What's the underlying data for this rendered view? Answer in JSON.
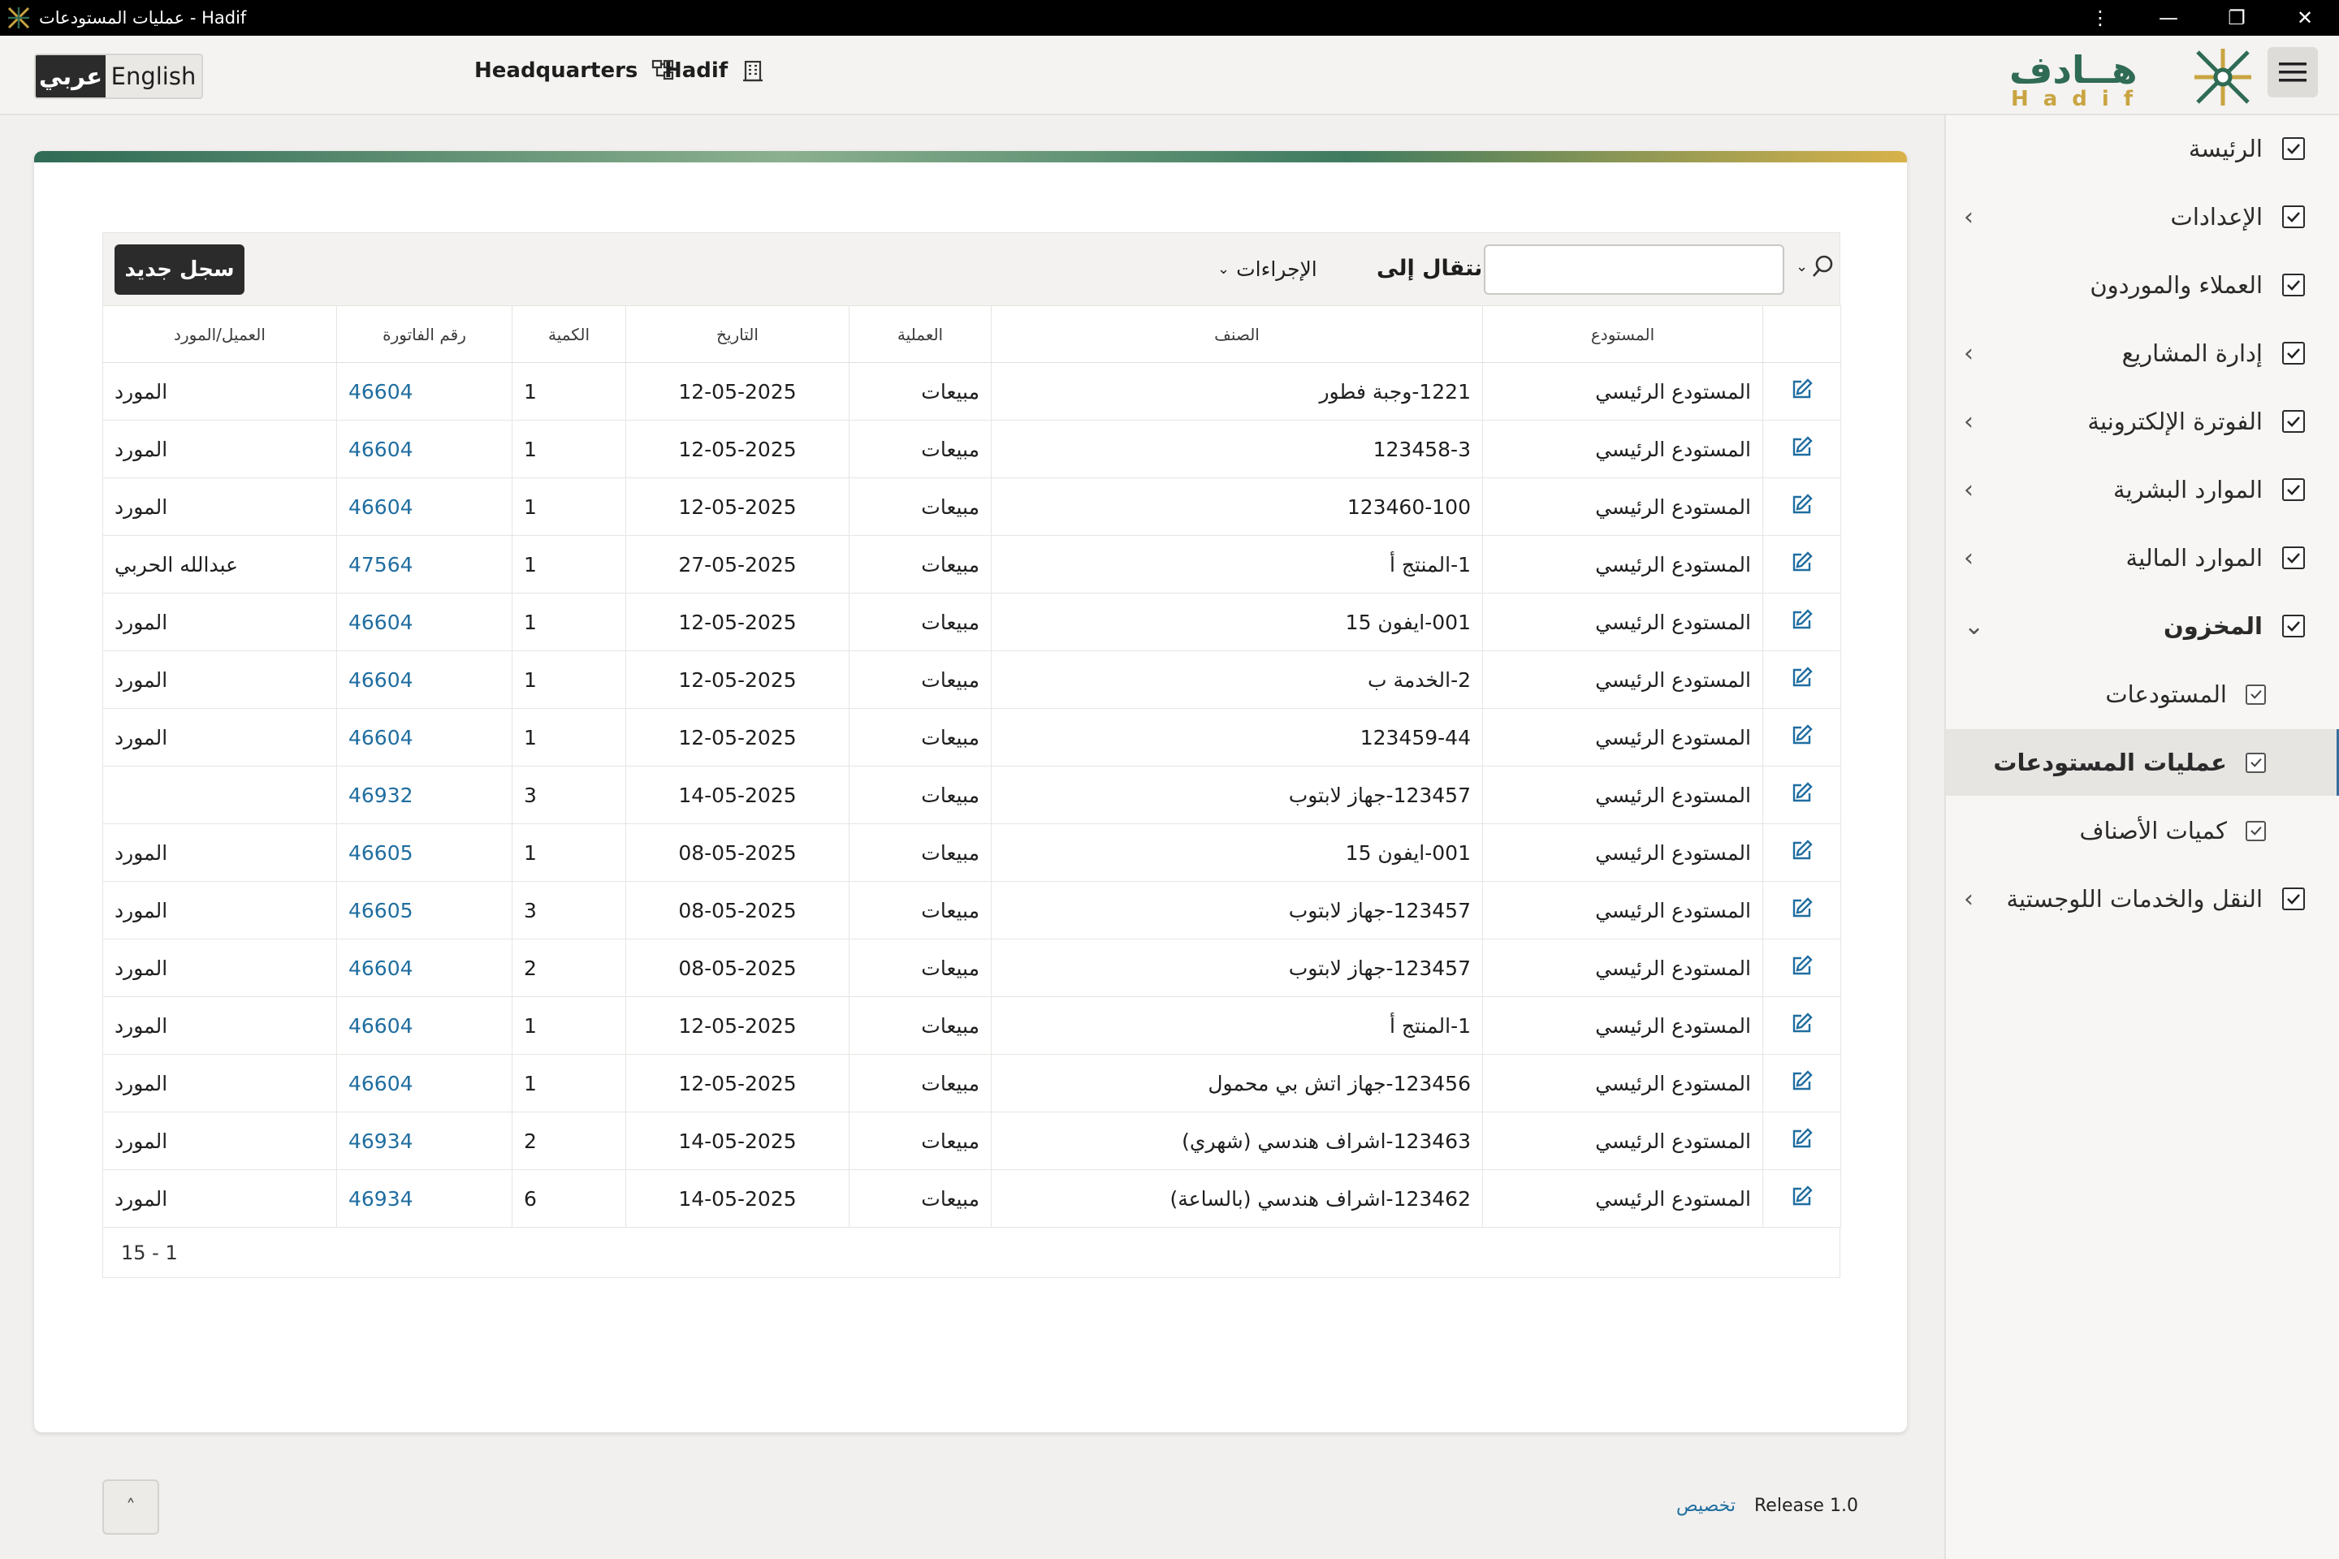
{
  "window": {
    "title": "عمليات المستودعات - Hadif",
    "controls": [
      "⋮",
      "—",
      "❐",
      "✕"
    ]
  },
  "header": {
    "lang_active": "عربي",
    "lang_inactive": "English",
    "branch": "Headquarters",
    "company": "Hadif",
    "logo_ar": "هــادف",
    "logo_en": "Hadif"
  },
  "sidebar": {
    "items": [
      {
        "label": "الرئيسة",
        "chevron": ""
      },
      {
        "label": "الإعدادات",
        "chevron": "‹"
      },
      {
        "label": "العملاء والموردون",
        "chevron": ""
      },
      {
        "label": "إدارة المشاريع",
        "chevron": "‹"
      },
      {
        "label": "الفوترة الإلكترونية",
        "chevron": "‹"
      },
      {
        "label": "الموارد البشرية",
        "chevron": "‹"
      },
      {
        "label": "الموارد المالية",
        "chevron": "‹"
      },
      {
        "label": "المخزون",
        "chevron": "⌄"
      },
      {
        "label": "المستودعات",
        "chevron": ""
      },
      {
        "label": "عمليات المستودعات",
        "chevron": ""
      },
      {
        "label": "كميات الأصناف",
        "chevron": ""
      },
      {
        "label": "النقل والخدمات اللوجستية",
        "chevron": "‹"
      }
    ]
  },
  "toolbar": {
    "new_record": "سجل جديد",
    "actions": "الإجراءات",
    "goto": "انتقال إلى",
    "search_placeholder": ""
  },
  "table": {
    "columns": [
      "",
      "المستودع",
      "الصنف",
      "العملية",
      "التاريخ",
      "الكمية",
      "رقم الفاتورة",
      "العميل/المورد"
    ],
    "rows": [
      {
        "warehouse": "المستودع الرئيسي",
        "item": "1221-وجبة فطور",
        "op": "مبيعات",
        "date": "12-05-2025",
        "qty": "1",
        "invoice": "46604",
        "party": "المورد"
      },
      {
        "warehouse": "المستودع الرئيسي",
        "item": "123458-3",
        "op": "مبيعات",
        "date": "12-05-2025",
        "qty": "1",
        "invoice": "46604",
        "party": "المورد"
      },
      {
        "warehouse": "المستودع الرئيسي",
        "item": "123460-100",
        "op": "مبيعات",
        "date": "12-05-2025",
        "qty": "1",
        "invoice": "46604",
        "party": "المورد"
      },
      {
        "warehouse": "المستودع الرئيسي",
        "item": "1-المنتج أ",
        "op": "مبيعات",
        "date": "27-05-2025",
        "qty": "1",
        "invoice": "47564",
        "party": "عبدالله الحربي"
      },
      {
        "warehouse": "المستودع الرئيسي",
        "item": "001-ايفون 15",
        "op": "مبيعات",
        "date": "12-05-2025",
        "qty": "1",
        "invoice": "46604",
        "party": "المورد"
      },
      {
        "warehouse": "المستودع الرئيسي",
        "item": "2-الخدمة ب",
        "op": "مبيعات",
        "date": "12-05-2025",
        "qty": "1",
        "invoice": "46604",
        "party": "المورد"
      },
      {
        "warehouse": "المستودع الرئيسي",
        "item": "123459-44",
        "op": "مبيعات",
        "date": "12-05-2025",
        "qty": "1",
        "invoice": "46604",
        "party": "المورد"
      },
      {
        "warehouse": "المستودع الرئيسي",
        "item": "123457-جهاز لابتوب",
        "op": "مبيعات",
        "date": "14-05-2025",
        "qty": "3",
        "invoice": "46932",
        "party": ""
      },
      {
        "warehouse": "المستودع الرئيسي",
        "item": "001-ايفون 15",
        "op": "مبيعات",
        "date": "08-05-2025",
        "qty": "1",
        "invoice": "46605",
        "party": "المورد"
      },
      {
        "warehouse": "المستودع الرئيسي",
        "item": "123457-جهاز لابتوب",
        "op": "مبيعات",
        "date": "08-05-2025",
        "qty": "3",
        "invoice": "46605",
        "party": "المورد"
      },
      {
        "warehouse": "المستودع الرئيسي",
        "item": "123457-جهاز لابتوب",
        "op": "مبيعات",
        "date": "08-05-2025",
        "qty": "2",
        "invoice": "46604",
        "party": "المورد"
      },
      {
        "warehouse": "المستودع الرئيسي",
        "item": "1-المنتج أ",
        "op": "مبيعات",
        "date": "12-05-2025",
        "qty": "1",
        "invoice": "46604",
        "party": "المورد"
      },
      {
        "warehouse": "المستودع الرئيسي",
        "item": "123456-جهاز اتش بي محمول",
        "op": "مبيعات",
        "date": "12-05-2025",
        "qty": "1",
        "invoice": "46604",
        "party": "المورد"
      },
      {
        "warehouse": "المستودع الرئيسي",
        "item": "123463-اشراف هندسي (شهري)",
        "op": "مبيعات",
        "date": "14-05-2025",
        "qty": "2",
        "invoice": "46934",
        "party": "المورد"
      },
      {
        "warehouse": "المستودع الرئيسي",
        "item": "123462-اشراف هندسي (بالساعة)",
        "op": "مبيعات",
        "date": "14-05-2025",
        "qty": "6",
        "invoice": "46934",
        "party": "المورد"
      }
    ],
    "pagination": "1 - 15"
  },
  "footer": {
    "customize": "تخصيص",
    "release": "Release 1.0",
    "scroll_top": "˄"
  },
  "colors": {
    "accent": "#1f6da0",
    "dark": "#2b2b2b",
    "logo_green": "#2f6b55",
    "logo_gold": "#c9a441"
  }
}
